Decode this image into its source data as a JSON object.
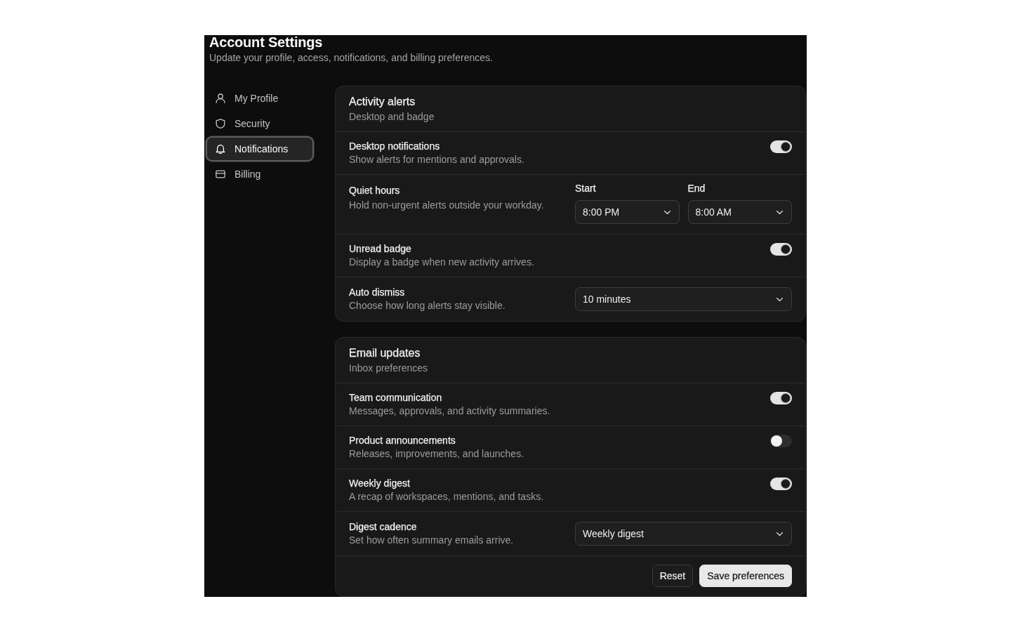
{
  "header": {
    "title": "Account Settings",
    "subtitle": "Update your profile, access, notifications, and billing preferences."
  },
  "sidebar": {
    "items": [
      {
        "label": "My Profile",
        "selected": false
      },
      {
        "label": "Security",
        "selected": false
      },
      {
        "label": "Notifications",
        "selected": true
      },
      {
        "label": "Billing",
        "selected": false
      }
    ]
  },
  "sections": [
    {
      "title": "Activity alerts",
      "subtitle": "Desktop and badge",
      "rows": [
        {
          "kind": "toggle",
          "label": "Desktop notifications",
          "description": "Show alerts for mentions and approvals.",
          "on": true
        },
        {
          "kind": "time_range",
          "label": "Quiet hours",
          "description": "Hold non-urgent alerts outside your workday.",
          "fields": [
            {
              "label": "Start",
              "value": "8:00 PM"
            },
            {
              "label": "End",
              "value": "8:00 AM"
            }
          ]
        },
        {
          "kind": "toggle",
          "label": "Unread badge",
          "description": "Display a badge when new activity arrives.",
          "on": true
        },
        {
          "kind": "select",
          "label": "Auto dismiss",
          "description": "Choose how long alerts stay visible.",
          "value": "10 minutes"
        }
      ]
    },
    {
      "title": "Email updates",
      "subtitle": "Inbox preferences",
      "rows": [
        {
          "kind": "toggle",
          "label": "Team communication",
          "description": "Messages, approvals, and activity summaries.",
          "on": true
        },
        {
          "kind": "toggle",
          "label": "Product announcements",
          "description": "Releases, improvements, and launches.",
          "on": false
        },
        {
          "kind": "toggle",
          "label": "Weekly digest",
          "description": "A recap of workspaces, mentions, and tasks.",
          "on": true
        },
        {
          "kind": "select",
          "label": "Digest cadence",
          "description": "Set how often summary emails arrive.",
          "value": "Weekly digest"
        }
      ],
      "actions": [
        {
          "kind": "secondary",
          "label": "Reset"
        },
        {
          "kind": "primary",
          "label": "Save preferences"
        }
      ]
    }
  ]
}
